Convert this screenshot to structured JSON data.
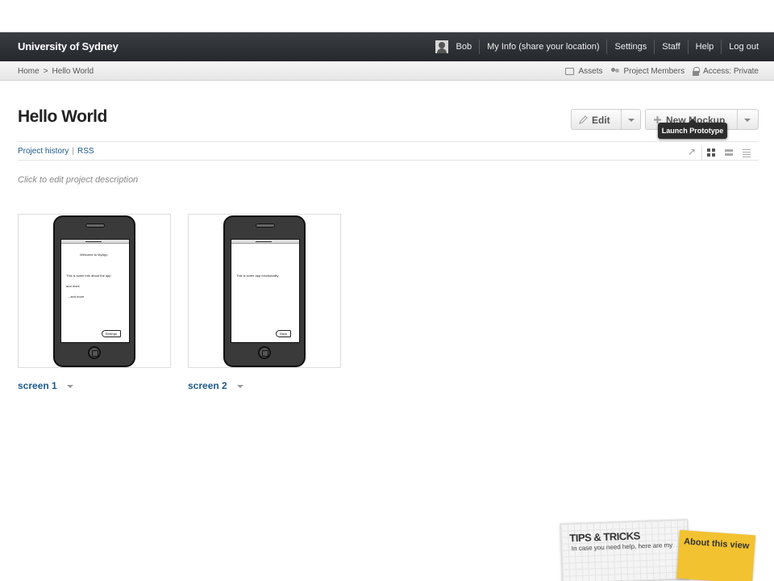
{
  "topbar": {
    "brand": "University of Sydney",
    "user": "Bob",
    "nav": [
      "My Info (share your location)",
      "Settings",
      "Staff",
      "Help",
      "Log out"
    ]
  },
  "breadcrumb": {
    "home": "Home",
    "separator": ">",
    "current": "Hello World"
  },
  "subnav": {
    "assets": "Assets",
    "members": "Project Members",
    "access": "Access: Private"
  },
  "project": {
    "title": "Hello World",
    "edit_label": "Edit",
    "new_mockup_label": "New Mockup",
    "tooltip": "Launch Prototype",
    "history_link": "Project history",
    "link_separator": "|",
    "rss_link": "RSS",
    "description_placeholder": "Click to edit project description"
  },
  "mockups": [
    {
      "name": "screen 1",
      "screen_lines": [
        "Welcome to MyApp",
        "This is some info about the app",
        "and more",
        "...and more"
      ],
      "button": "Settings"
    },
    {
      "name": "screen 2",
      "screen_lines": [
        "This is some app functionality"
      ],
      "button": "Back"
    }
  ],
  "tips": {
    "title": "TIPS & TRICKS",
    "text": "In case you need help, here are my",
    "about": "About this view"
  },
  "colors": {
    "topbar": "#2f3338",
    "link": "#1d5a8c",
    "tooltip": "#2c2c2c",
    "note": "#f2c230"
  },
  "icons": [
    "user-avatar-icon",
    "assets-icon",
    "members-icon",
    "lock-icon",
    "pencil-icon",
    "plus-icon",
    "launch-arrow-icon",
    "grid-view-icon",
    "list-view-icon",
    "compact-list-icon"
  ]
}
